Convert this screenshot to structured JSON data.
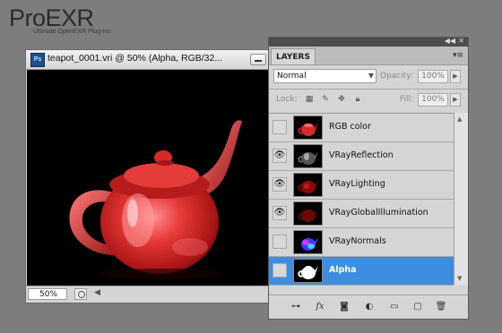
{
  "logo": {
    "title": "ProEXR",
    "subtitle": "Ultimate OpenEXR Plug-Ins"
  },
  "document": {
    "app_icon": "Ps",
    "title": "teapot_0001.vri @ 50% (Alpha, RGB/32...",
    "zoom": "50%"
  },
  "layers_panel": {
    "tab": "LAYERS",
    "blend_mode": "Normal",
    "opacity_label": "Opacity:",
    "opacity_value": "100%",
    "lock_label": "Lock:",
    "fill_label": "Fill:",
    "fill_value": "100%",
    "layers": [
      {
        "name": "RGB color",
        "visible": false,
        "selected": false,
        "thumb": "teapot-red"
      },
      {
        "name": "VRayReflection",
        "visible": true,
        "selected": false,
        "thumb": "teapot-gray"
      },
      {
        "name": "VRayLighting",
        "visible": true,
        "selected": false,
        "thumb": "teapot-darkred"
      },
      {
        "name": "VRayGlobalIllumination",
        "visible": true,
        "selected": false,
        "thumb": "teapot-darkred"
      },
      {
        "name": "VRayNormals",
        "visible": false,
        "selected": false,
        "thumb": "teapot-normals"
      },
      {
        "name": "Alpha",
        "visible": false,
        "selected": true,
        "thumb": "teapot-alpha"
      }
    ]
  },
  "colors": {
    "selected_row": "#3d8ee0",
    "background": "#7d7d7d"
  }
}
